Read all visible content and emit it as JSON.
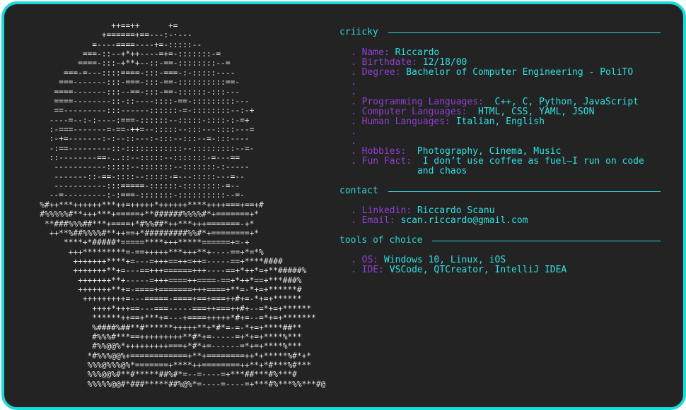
{
  "ascii_art": "                  ++==++      +=\n                +======+==---:-·---\n              =----====----+=-:::::--\n            ===-::--+*++----=+=-:::::::-=\n           ====-:::-+**+--::-==-::::::::--=\n        ===-=---::::====-:::-===-:-:::::----\n       ===-------:::-===-:::-==-::::::::::==-\n      ====-------:::--==-:::-==-::::::-:::---\n      ====--------::-::----::::-==-:::::::::---\n      ==---------:::------::::::-=-::::::::--:-+\n     ----=--:-:----:===-::::::--:::::-::::-:-=+\n     :-===-------=-==-++=--:::::--:::---::::---=\n     :-+=-------:-:--::---:-:::--:::--=-:::----\n     -:==---------::-::::::::::::--:::::::::--=-\n     ::--------==-..::--:::::--:::::::-=---==\n      -----------:::::--:::::::--:::::::-:-----\n      -------::-==-::::--:::::-=---:::::---=--\n      -----------:::=====-::::::-::::::::-=--\n     --=---------:-:===-:::::::-::::::::::--=-\n   %#++***++++++***++=+++++*++++++****++++===+==+#\n   #%%%%%#**+++***+=====+**######%%%%#*+=======+*\n    **###%%%##***+====+*#%%##*++***+++=======-+*\n     ++**%##%%%%#**++==+*#########%%#*+========+*\n        ****+*#####*=====****+++*****======+=-+\n         +++*********=-==+++++***+++**+----==+*=*%\n          +++++++****+=---=+++==++=++=-----==+****####\n          +++++++**+=---==+++======+++----==+*++*=+**#####%\n           +++++++**+-----=+++====++====-==+*++*==+***###%\n           +++++++**+=-====+=======+++====+**=-*+=+******#\n            +++++++++=---=====-====+==+===++#+=-*+=+******\n              ++++*+++==---===-----===++===++#+--=*+=+******\n              ******++==+***+=---+====+++++*#+=--=*+=+*******\n              %####%##**#******+++++**+*#*=-=-*+=+****##**\n              #%%%#***==+++++++++**#*+=-----=+*+=+****%***\n              #%%@@%*+++++++++===+*#*+=------=*+=+****%***\n             *#%%%@@%+============+**+========++*+*****%#*+*\n             %%%@%%%@%*=======+****++========++**+*#***%#***\n             %%%@@%#**#*****##%#*=--=----=+***##***#%***#\n             %%%%%@@#*###*****##%@%*=----=----=+***#%***%%***#@",
  "sections": [
    {
      "heading": "criicky",
      "rows": [
        {
          "key": "Name:",
          "value": "Riccardo"
        },
        {
          "key": "Birthdate:",
          "value": "12/18/00"
        },
        {
          "key": "Degree:",
          "value": "Bachelor of Computer Engineering - PoliTO"
        },
        {
          "key": "",
          "value": ""
        },
        {
          "key": "",
          "value": ""
        },
        {
          "key": "Programming Languages:",
          "value": " C++, C, Python, JavaScript"
        },
        {
          "key": "Computer Languages:",
          "value": " HTML, CSS, YAML, JSON"
        },
        {
          "key": "Human Languages:",
          "value": "Italian, English"
        },
        {
          "key": "",
          "value": ""
        },
        {
          "key": "",
          "value": ""
        },
        {
          "key": "Hobbies:",
          "value": " Photography, Cinema, Music"
        },
        {
          "key": "Fun Fact:",
          "value": " I don’t use coffee as fuel—I run on code\nand chaos"
        }
      ]
    },
    {
      "heading": "contact",
      "rows": [
        {
          "key": "Linkedin:",
          "value": "Riccardo Scanu"
        },
        {
          "key": "Email:",
          "value": "scan.riccardo@gmail.com"
        }
      ]
    },
    {
      "heading": "tools of choice",
      "rows": [
        {
          "key": "OS:",
          "value": "Windows 10, Linux, iOS"
        },
        {
          "key": "IDE:",
          "value": "VSCode, QTCreator, IntelliJ IDEA"
        }
      ]
    }
  ],
  "bullet": ".",
  "colors": {
    "background": "#232323",
    "border": "#19d9dc",
    "heading": "#2fd6d9",
    "key": "#8f3fd2",
    "value": "#2fe1e3",
    "ascii": "#e6e6e6"
  }
}
